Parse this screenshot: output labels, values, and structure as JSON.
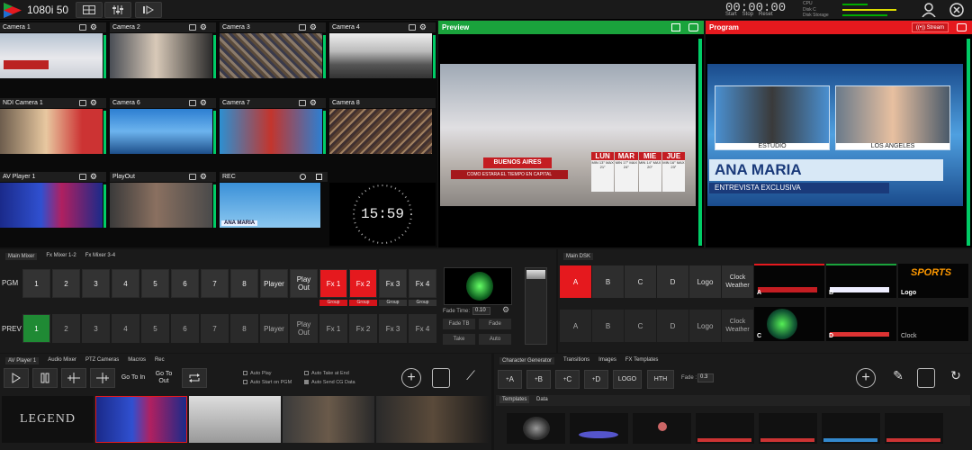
{
  "topbar": {
    "format": "1080i 50",
    "timer": "00:00:00",
    "timer_controls": [
      "Start",
      "Stop",
      "Reset"
    ],
    "meters": [
      "CPU",
      "Disk C",
      "Disk Storage"
    ]
  },
  "multiview": {
    "tiles": [
      {
        "label": "Camera 1"
      },
      {
        "label": "Camera 2"
      },
      {
        "label": "Camera 3"
      },
      {
        "label": "Camera 4"
      },
      {
        "label": "NDI Camera 1"
      },
      {
        "label": "Camera 6"
      },
      {
        "label": "Camera 7"
      },
      {
        "label": "Camera 8"
      },
      {
        "label": "AV Player 1"
      },
      {
        "label": "PlayOut"
      },
      {
        "label": "REC"
      }
    ],
    "rec_thumb_caption": "ANA MARIA",
    "clock": "15:59"
  },
  "preview": {
    "title": "Preview",
    "graphic_city": "BUENOS AIRES",
    "graphic_sub": "COMO ESTARA EL TIEMPO EN CAPITAL",
    "days": [
      {
        "day": "LUN",
        "info": "MIN 13° MAX 21°"
      },
      {
        "day": "MAR",
        "info": "MIN 17° MAX 24°"
      },
      {
        "day": "MIE",
        "info": "MIN 14° MAX 20°"
      },
      {
        "day": "JUE",
        "info": "MIN 16° MAX 23°"
      }
    ]
  },
  "program": {
    "title": "Program",
    "stream_label": "Stream",
    "left_tag": "ESTUDIO",
    "right_tag": "LOS ANGELES",
    "name": "ANA MARIA",
    "subtitle": "ENTREVISTA EXCLUSIVA"
  },
  "mixer": {
    "tabs": [
      "Main Mixer",
      "Fx Mixer 1-2",
      "Fx Mixer 3-4"
    ],
    "pgm_label": "PGM",
    "prev_label": "PREV",
    "numbers": [
      "1",
      "2",
      "3",
      "4",
      "5",
      "6",
      "7",
      "8"
    ],
    "player": "Player",
    "play_out": "Play Out",
    "fx": [
      "Fx 1",
      "Fx 2",
      "Fx 3",
      "Fx 4"
    ],
    "group": "Group",
    "fade_time_label": "Fade Time:",
    "fade_time_value": "0.10",
    "controls": [
      "Fade TB",
      "Fade",
      "Take",
      "Auto"
    ]
  },
  "dsk": {
    "tab": "Main DSK",
    "buttons": [
      "A",
      "B",
      "C",
      "D",
      "Logo"
    ],
    "clock_weather": "Clock Weather",
    "thumbs": [
      {
        "label": "A"
      },
      {
        "label": "B"
      },
      {
        "label": "Logo"
      },
      {
        "label": "C"
      },
      {
        "label": "D"
      },
      {
        "label": "Clock"
      }
    ]
  },
  "player": {
    "tabs": [
      "AV Player 1",
      "Audio Mixer",
      "PTZ Cameras",
      "Macros",
      "Rec"
    ],
    "goto_in": "Go To In",
    "goto_out": "Go To Out",
    "options": [
      "Auto Play",
      "Auto Start on PGM",
      "Auto Take at End",
      "Auto Send CG Data"
    ],
    "logo_text": "LEGEND"
  },
  "cg": {
    "tabs": [
      "Character Generator",
      "Transitions",
      "Images",
      "FX Templates"
    ],
    "buttons": [
      "A",
      "B",
      "C",
      "D",
      "LOGO",
      "HTH"
    ],
    "fade_label": "Fade :",
    "fade_value": "0.3",
    "subtabs": [
      "Templates",
      "Data"
    ]
  },
  "colors": {
    "accent_red": "#e5191e",
    "preview_green": "#1aa33c",
    "vu_green": "#00cc66"
  }
}
